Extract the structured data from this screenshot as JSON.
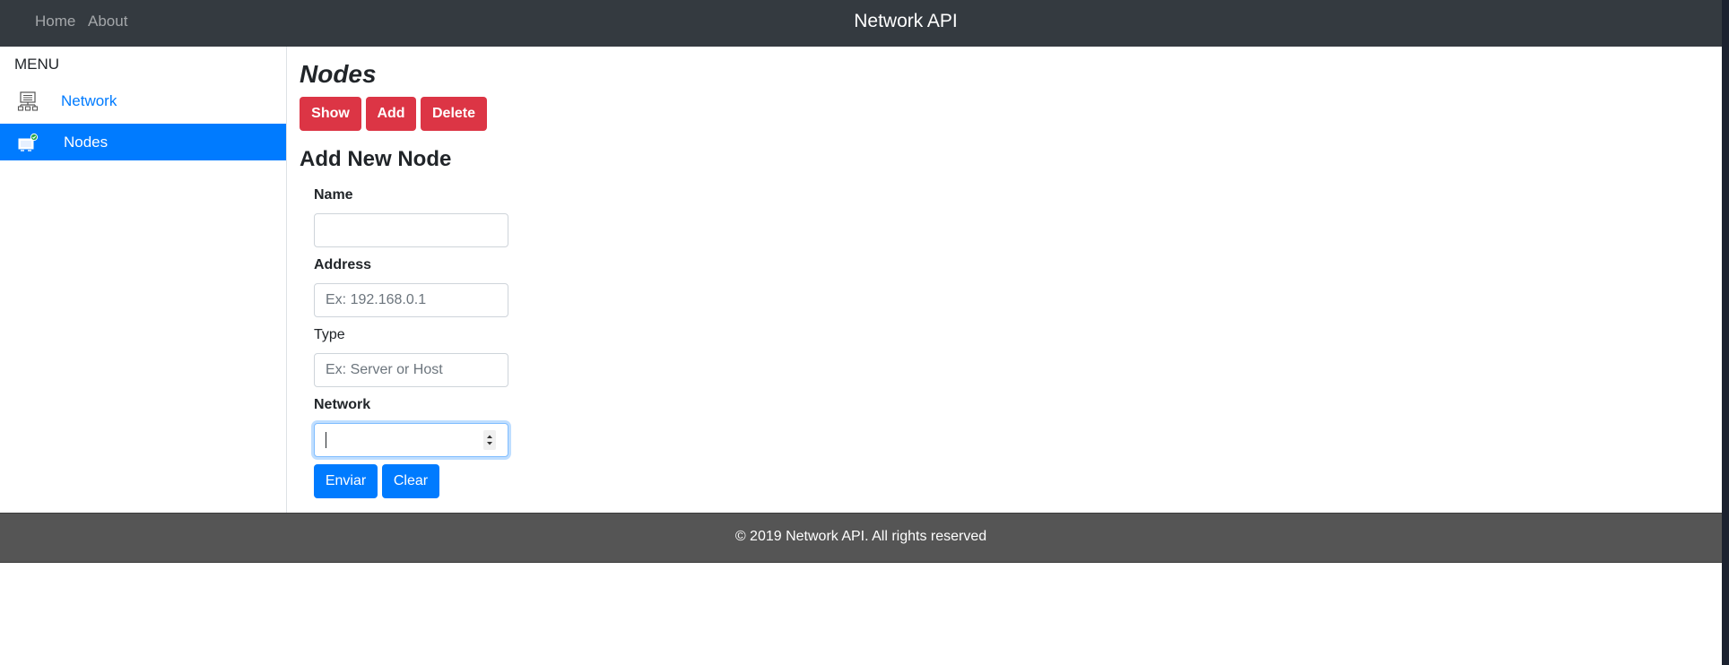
{
  "navbar": {
    "links": [
      {
        "label": "Home"
      },
      {
        "label": "About"
      }
    ],
    "brand": "Network API"
  },
  "sidebar": {
    "title": "MENU",
    "items": [
      {
        "label": "Network",
        "icon": "network-icon",
        "active": false
      },
      {
        "label": "Nodes",
        "icon": "nodes-icon",
        "active": true
      }
    ]
  },
  "main": {
    "title": "Nodes",
    "actions": [
      {
        "label": "Show"
      },
      {
        "label": "Add"
      },
      {
        "label": "Delete"
      }
    ],
    "form": {
      "heading": "Add New Node",
      "fields": [
        {
          "label": "Name",
          "value": "",
          "placeholder": ""
        },
        {
          "label": "Address",
          "value": "",
          "placeholder": "Ex: 192.168.0.1"
        },
        {
          "label": "Type",
          "value": "",
          "placeholder": "Ex: Server or Host"
        },
        {
          "label": "Network",
          "value": "",
          "placeholder": ""
        }
      ],
      "submit_label": "Enviar",
      "clear_label": "Clear"
    }
  },
  "footer": {
    "text": "© 2019 Network API. All rights reserved"
  },
  "colors": {
    "navbar": "#343a40",
    "accent": "#007bff",
    "danger": "#dc3545",
    "footer": "#555555"
  }
}
